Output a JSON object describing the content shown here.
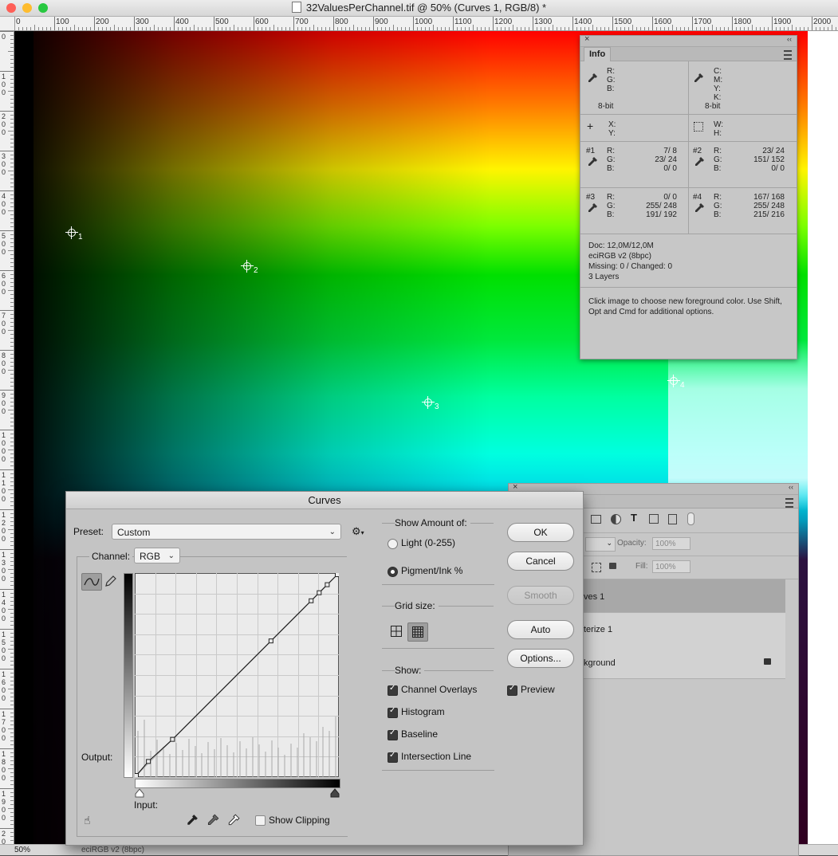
{
  "window": {
    "title": "32ValuesPerChannel.tif @ 50% (Curves 1, RGB/8) *",
    "traffic_light_colors": [
      "#fe5f57",
      "#febc2e",
      "#28c840"
    ]
  },
  "ruler": {
    "top_ticks": [
      "0",
      "100",
      "200",
      "300",
      "400",
      "500",
      "600",
      "700",
      "800",
      "900",
      "1000",
      "1100",
      "1200",
      "1300",
      "1400",
      "1500",
      "1600",
      "1700",
      "1800",
      "1900",
      "2000"
    ],
    "left_ticks": [
      "0",
      "100",
      "200",
      "300",
      "400",
      "500",
      "600",
      "700",
      "800",
      "900",
      "1000",
      "1100",
      "1200",
      "1300",
      "1400",
      "1500",
      "1600",
      "1700",
      "1800",
      "1900",
      "2000"
    ]
  },
  "color_samplers": [
    "1",
    "2",
    "3",
    "4"
  ],
  "status": {
    "zoom": "50%",
    "profile": "eciRGB v2 (8bpc)"
  },
  "info_panel": {
    "tab": "Info",
    "rgb_labels": {
      "r": "R:",
      "g": "G:",
      "b": "B:"
    },
    "cmyk_labels": {
      "c": "C:",
      "m": "M:",
      "y": "Y:",
      "k": "K:"
    },
    "bit_depth_left": "8-bit",
    "bit_depth_right": "8-bit",
    "xy_labels": {
      "x": "X:",
      "y": "Y:"
    },
    "wh_labels": {
      "w": "W:",
      "h": "H:"
    },
    "samplers": [
      {
        "id": "#1",
        "r": "7/   8",
        "g": "23/  24",
        "b": "0/   0"
      },
      {
        "id": "#2",
        "r": "23/  24",
        "g": "151/ 152",
        "b": "0/   0"
      },
      {
        "id": "#3",
        "r": "0/   0",
        "g": "255/ 248",
        "b": "191/ 192"
      },
      {
        "id": "#4",
        "r": "167/ 168",
        "g": "255/ 248",
        "b": "215/ 216"
      }
    ],
    "doc_lines": [
      "Doc: 12,0M/12,0M",
      "eciRGB v2 (8bpc)",
      "Missing: 0 / Changed: 0",
      "3 Layers"
    ],
    "hint": "Click image to choose new foreground color.  Use Shift, Opt and Cmd for additional options."
  },
  "layers_panel": {
    "opacity_label": "Opacity:",
    "opacity_value": "100%",
    "fill_label": "Fill:",
    "fill_value": "100%",
    "layers": [
      "ves 1",
      "terize 1",
      "kground"
    ]
  },
  "curves": {
    "title": "Curves",
    "preset_label": "Preset:",
    "preset_value": "Custom",
    "channel_label": "Channel:",
    "channel_value": "RGB",
    "output_label": "Output:",
    "input_label": "Input:",
    "show_clipping_label": "Show Clipping",
    "show_clipping_checked": false,
    "show_amount_title": "Show Amount of:",
    "light_label": "Light  (0-255)",
    "pigment_label": "Pigment/Ink %",
    "show_amount_selected": "pigment",
    "grid_size_title": "Grid size:",
    "show_title": "Show:",
    "show_options": [
      {
        "label": "Channel Overlays",
        "checked": true
      },
      {
        "label": "Histogram",
        "checked": true
      },
      {
        "label": "Baseline",
        "checked": true
      },
      {
        "label": "Intersection Line",
        "checked": true
      }
    ],
    "buttons": {
      "ok": "OK",
      "cancel": "Cancel",
      "smooth": "Smooth",
      "auto": "Auto",
      "options": "Options..."
    },
    "preview_label": "Preview",
    "preview_checked": true,
    "curve_points": [
      [
        0,
        0
      ],
      [
        6,
        7
      ],
      [
        18,
        18
      ],
      [
        67,
        67
      ],
      [
        87,
        87
      ],
      [
        91,
        91
      ],
      [
        95,
        95
      ],
      [
        100,
        100
      ]
    ]
  }
}
